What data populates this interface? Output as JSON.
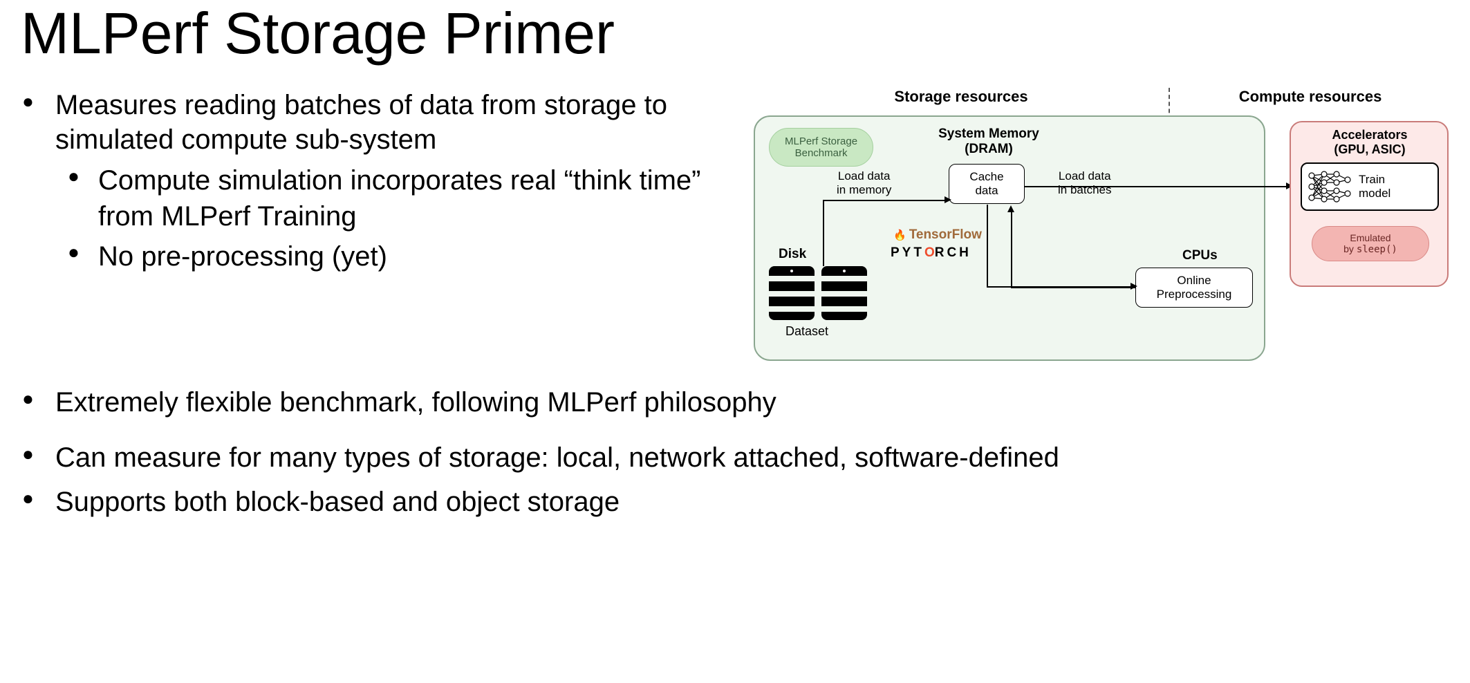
{
  "title": "MLPerf Storage Primer",
  "bullets": {
    "b1": "Measures reading batches of data from storage to simulated compute sub-system",
    "b1a": "Compute simulation incorporates real “think time” from MLPerf Training",
    "b1b": "No pre-processing (yet)",
    "b2": "Extremely flexible benchmark, following MLPerf philosophy",
    "b3": "Can measure for many types of storage: local, network attached, software-defined",
    "b4": "Supports both block-based and object storage"
  },
  "diagram": {
    "storage_header": "Storage resources",
    "compute_header": "Compute resources",
    "mlperf_pill_l1": "MLPerf Storage",
    "mlperf_pill_l2": "Benchmark",
    "sysmem_l1": "System Memory",
    "sysmem_l2": "(DRAM)",
    "cache_l1": "Cache",
    "cache_l2": "data",
    "disk_label": "Disk",
    "dataset_label": "Dataset",
    "tf_label": "TensorFlow",
    "pytorch_pre": "PYT",
    "pytorch_o": "O",
    "pytorch_post": "RCH",
    "load_mem_l1": "Load data",
    "load_mem_l2": "in memory",
    "load_batch_l1": "Load data",
    "load_batch_l2": "in batches",
    "cpus_label": "CPUs",
    "cpu_box_l1": "Online",
    "cpu_box_l2": "Preprocessing",
    "accel_l1": "Accelerators",
    "accel_l2": "(GPU, ASIC)",
    "train_l1": "Train",
    "train_l2": "model",
    "emul_l1": "Emulated",
    "emul_l2_pre": "by ",
    "emul_l2_code": "sleep()"
  }
}
